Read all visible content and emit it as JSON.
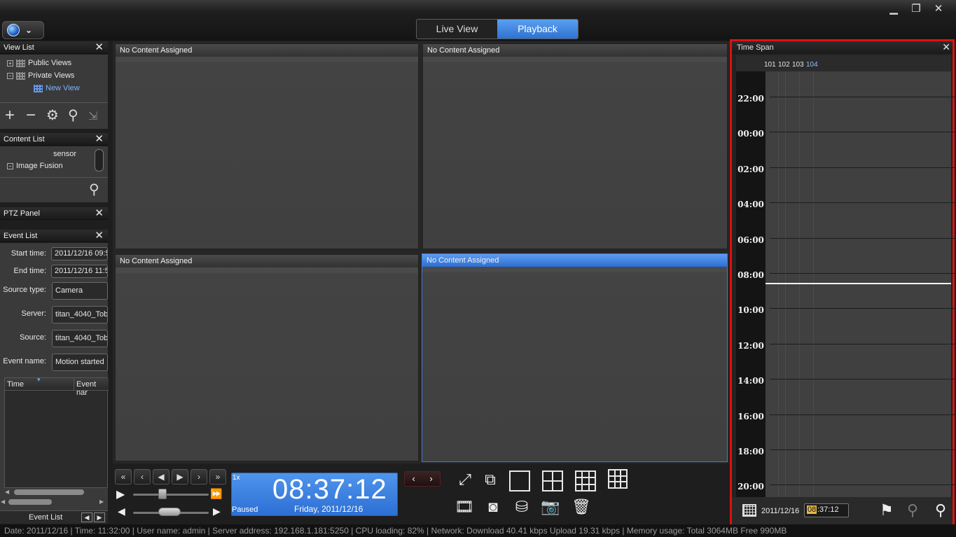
{
  "window": {
    "minimize": "▁",
    "restore": "❐",
    "close": "✕"
  },
  "mode_tabs": [
    {
      "label": "Live View",
      "active": false
    },
    {
      "label": "Playback",
      "active": true
    }
  ],
  "view_list": {
    "title": "View List",
    "items": [
      {
        "label": "Public Views"
      },
      {
        "label": "Private Views"
      },
      {
        "label": "New View"
      }
    ]
  },
  "content_list": {
    "title": "Content List",
    "items": [
      {
        "label": "sensor"
      },
      {
        "label": "Image Fusion"
      }
    ]
  },
  "ptz_panel": {
    "title": "PTZ Panel"
  },
  "event_list": {
    "title": "Event List",
    "start_label": "Start time:",
    "start_value": "2011/12/16 09:5",
    "end_label": "End time:",
    "end_value": "2011/12/16 11:5",
    "source_type_label": "Source type:",
    "source_type_value": "Camera",
    "server_label": "Server:",
    "server_value": "titan_4040_Tob",
    "source_label": "Source:",
    "source_value": "titan_4040_Tob",
    "event_name_label": "Event name:",
    "event_name_value": "Motion started",
    "col_time": "Time",
    "col_event": "Event nar",
    "footer_tab": "Event List"
  },
  "tiles": [
    {
      "label": "No Content Assigned",
      "selected": false
    },
    {
      "label": "No Content Assigned",
      "selected": false
    },
    {
      "label": "No Content Assigned",
      "selected": false
    },
    {
      "label": "No Content Assigned",
      "selected": true
    }
  ],
  "playback": {
    "speed": "1x",
    "time": "08:37:12",
    "state": "Paused",
    "date": "Friday, 2011/12/16"
  },
  "time_span": {
    "title": "Time Span",
    "channels": [
      "101",
      "102",
      "103",
      "104"
    ],
    "hours": [
      "22:00",
      "00:00",
      "02:00",
      "04:00",
      "06:00",
      "08:00",
      "10:00",
      "12:00",
      "14:00",
      "16:00",
      "18:00",
      "20:00"
    ],
    "date": "2011/12/16",
    "time_hh": "08",
    "time_rest": ":37:12"
  },
  "status_bar": "Date: 2011/12/16  |  Time: 11:32:00  |  User name: admin  |  Server address: 192.168.1.181:5250  |  CPU loading: 82%  |  Network: Download    40.41 kbps Upload    19.31 kbps  |  Memory usage: Total 3064MB  Free 990MB"
}
